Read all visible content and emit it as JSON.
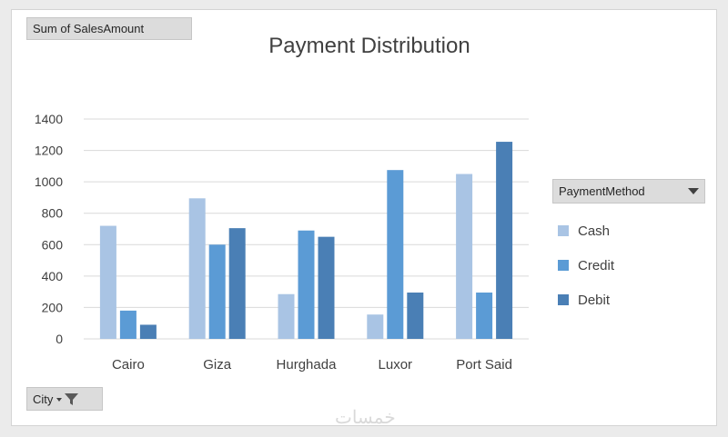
{
  "pivot": {
    "values_field": "Sum of SalesAmount",
    "legend_field": "PaymentMethod",
    "axis_field": "City"
  },
  "watermark": "خمسات",
  "colors": {
    "cash": "#a9c4e4",
    "credit": "#5b9bd5",
    "debit": "#4a7fb5",
    "grid": "#d9d9d9",
    "text": "#404040"
  },
  "chart_data": {
    "type": "bar",
    "title": "Payment Distribution",
    "xlabel": "",
    "ylabel": "",
    "categories": [
      "Cairo",
      "Giza",
      "Hurghada",
      "Luxor",
      "Port Said"
    ],
    "series": [
      {
        "name": "Cash",
        "values": [
          720,
          895,
          285,
          155,
          1050
        ]
      },
      {
        "name": "Credit",
        "values": [
          180,
          600,
          690,
          1075,
          295
        ]
      },
      {
        "name": "Debit",
        "values": [
          90,
          705,
          650,
          295,
          1255
        ]
      }
    ],
    "yticks": [
      "0",
      "200",
      "400",
      "600",
      "800",
      "1000",
      "1200",
      "1400"
    ],
    "ylim": [
      0,
      1400
    ],
    "grid": true,
    "legend_position": "right"
  }
}
